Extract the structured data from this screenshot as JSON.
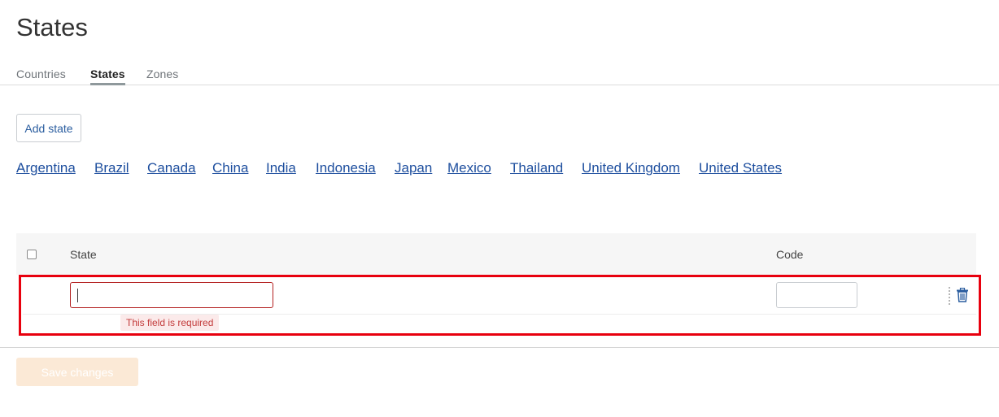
{
  "page": {
    "title": "States"
  },
  "tabs": [
    {
      "label": "Countries",
      "active": false
    },
    {
      "label": "States",
      "active": true
    },
    {
      "label": "Zones",
      "active": false
    }
  ],
  "actions": {
    "add_state_label": "Add state"
  },
  "country_links": [
    "Argentina",
    "Brazil",
    "Canada",
    "China",
    "India",
    "Indonesia",
    "Japan",
    "Mexico",
    "Thailand",
    "United Kingdom",
    "United States"
  ],
  "table": {
    "headers": {
      "state": "State",
      "code": "Code"
    },
    "row": {
      "state_value": "",
      "code_value": "",
      "error": "This field is required"
    }
  },
  "footer": {
    "save_label": "Save changes",
    "save_enabled": false
  },
  "colors": {
    "link": "#1d4e9e",
    "error": "#b32020",
    "highlight": "#e8000e",
    "save_disabled": "#fbe9d6"
  },
  "icons": {
    "row_delete": "trash-icon",
    "row_drag": "drag-handle-icon"
  }
}
